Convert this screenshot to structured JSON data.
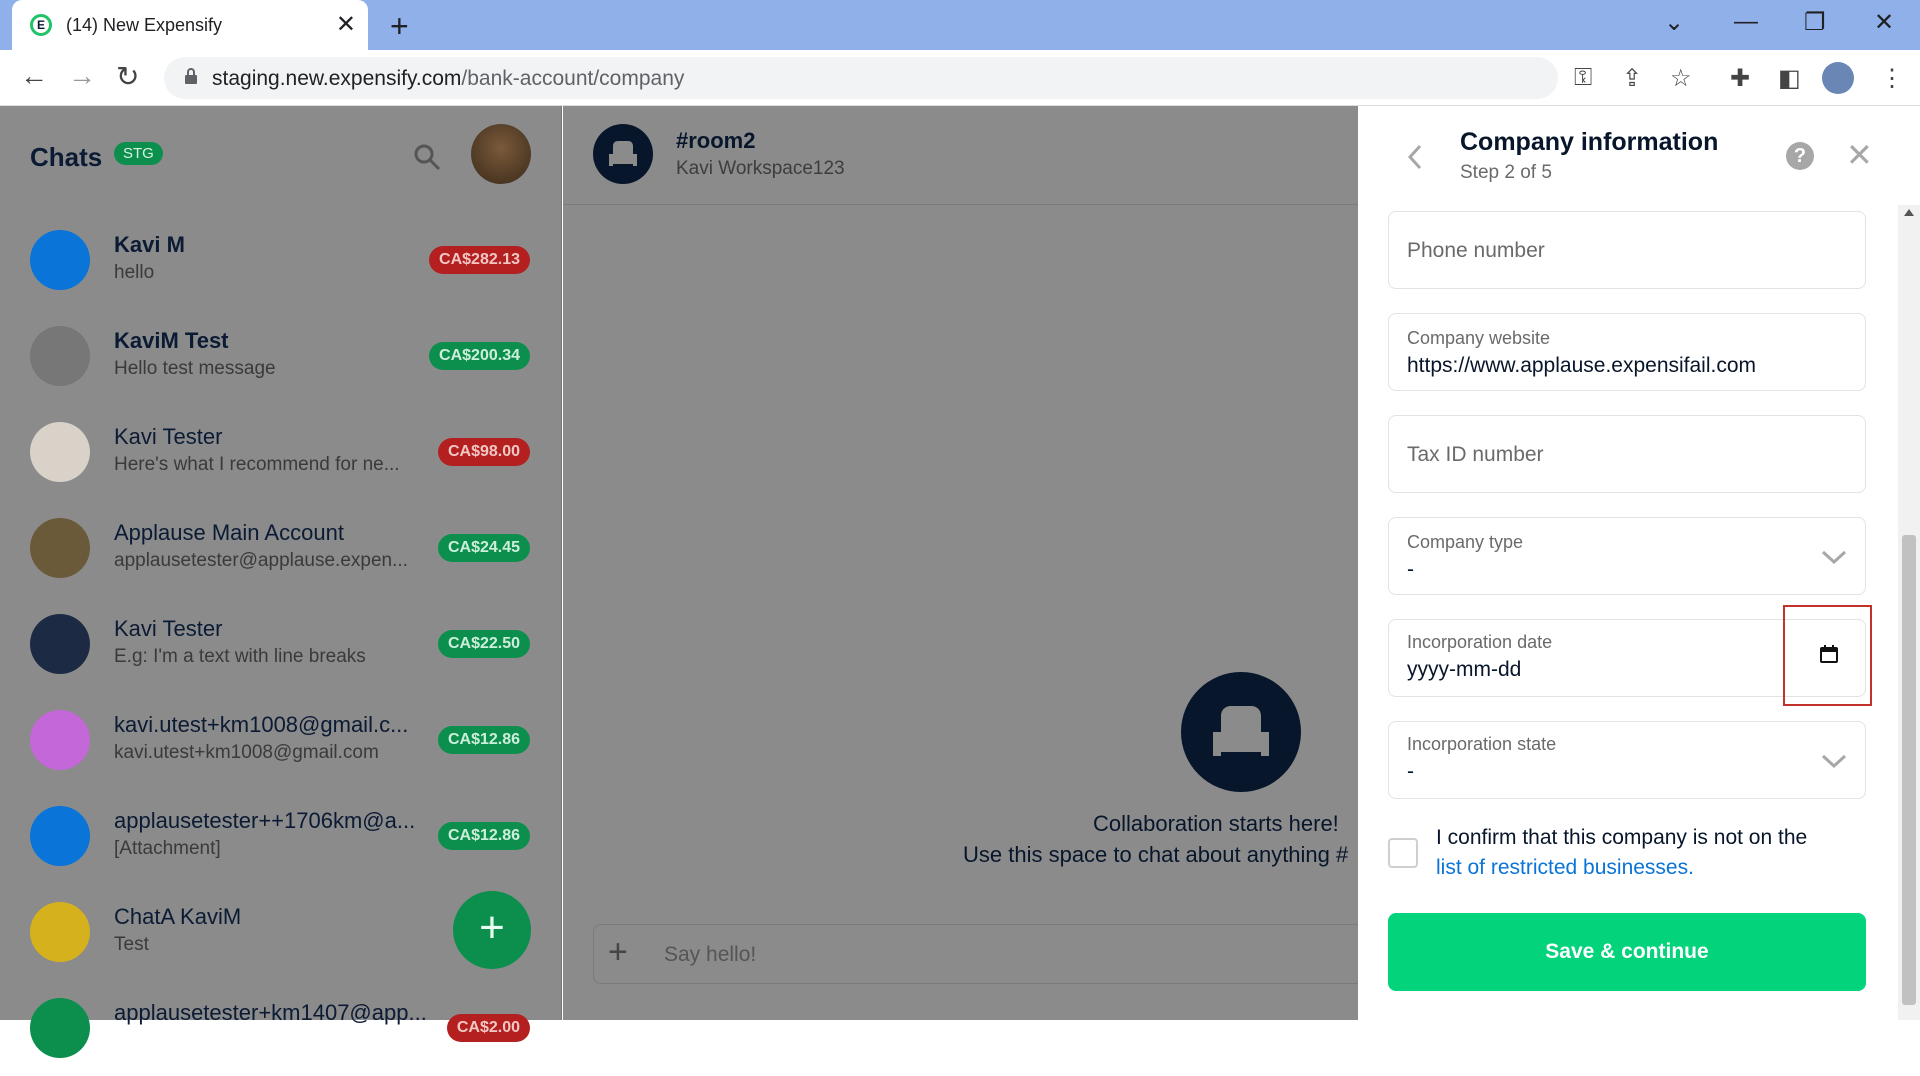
{
  "browser": {
    "tab_title": "(14) New Expensify",
    "url_host": "staging.new.expensify.com",
    "url_path": "/bank-account/company"
  },
  "sidebar": {
    "title": "Chats",
    "env_badge": "STG",
    "chats": [
      {
        "name": "Kavi M",
        "preview": "hello",
        "amount": "CA$282.13",
        "status": "red",
        "bold": true
      },
      {
        "name": "KaviM Test",
        "preview": "Hello test message",
        "amount": "CA$200.34",
        "status": "green",
        "bold": true
      },
      {
        "name": "Kavi Tester",
        "preview": "Here's what I recommend for ne...",
        "amount": "CA$98.00",
        "status": "red",
        "bold": false
      },
      {
        "name": "Applause Main Account",
        "preview": "applausetester@applause.expen...",
        "amount": "CA$24.45",
        "status": "green",
        "bold": false
      },
      {
        "name": "Kavi Tester",
        "preview": "E.g: I'm a text with line breaks",
        "amount": "CA$22.50",
        "status": "green",
        "bold": false
      },
      {
        "name": "kavi.utest+km1008@gmail.c...",
        "preview": "kavi.utest+km1008@gmail.com",
        "amount": "CA$12.86",
        "status": "green",
        "bold": false
      },
      {
        "name": "applausetester++1706km@a...",
        "preview": "[Attachment]",
        "amount": "CA$12.86",
        "status": "green",
        "bold": false
      },
      {
        "name": "ChatA KaviM",
        "preview": "Test",
        "amount": "",
        "status": "green",
        "bold": false
      },
      {
        "name": "applausetester+km1407@app...",
        "preview": "",
        "amount": "CA$2.00",
        "status": "red",
        "bold": false
      }
    ]
  },
  "main": {
    "room_name": "#room2",
    "workspace": "Kavi Workspace123",
    "empty_title": "Collaboration starts here!",
    "empty_sub": "Use this space to chat about anything #",
    "composer_placeholder": "Say hello!"
  },
  "panel": {
    "title": "Company information",
    "step": "Step 2 of 5",
    "phone_placeholder": "Phone number",
    "website_label": "Company website",
    "website_value": "https://www.applause.expensifail.com",
    "taxid_placeholder": "Tax ID number",
    "company_type_label": "Company type",
    "company_type_value": "-",
    "inc_date_label": "Incorporation date",
    "inc_date_value": "yyyy-mm-dd",
    "inc_state_label": "Incorporation state",
    "inc_state_value": "-",
    "confirm_text": "I confirm that this company is not on the",
    "confirm_link": "list of restricted businesses.",
    "save_label": "Save & continue"
  },
  "colors": {
    "accent_green": "#03d47c",
    "badge_red": "#b3201f",
    "badge_green": "#0c8f4d",
    "link_blue": "#0a74d8"
  }
}
